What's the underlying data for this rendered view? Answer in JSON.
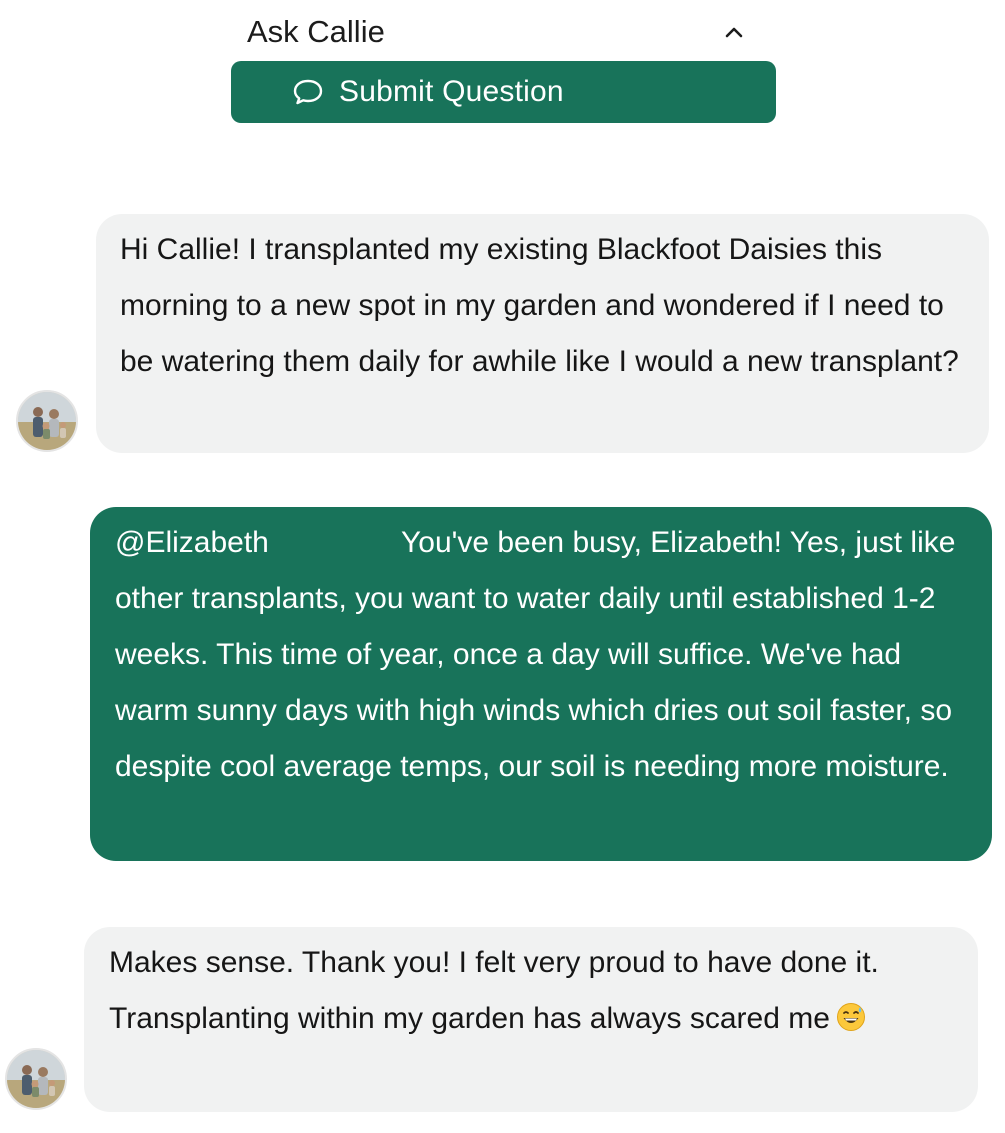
{
  "panel": {
    "title": "Ask Callie",
    "collapse_icon": "chevron-up-icon"
  },
  "submit_button": {
    "label": "Submit Question",
    "icon": "speech-bubble-icon"
  },
  "messages": [
    {
      "sender": "user",
      "text": "Hi Callie! I transplanted my existing Blackfoot Daisies this morning to a new spot in my garden and wondered if I need to be watering them daily for awhile like I would a new transplant?"
    },
    {
      "sender": "expert",
      "mention": "@Elizabeth",
      "text": "You've been busy, Elizabeth! Yes, just like other transplants, you want to water daily until established 1-2 weeks. This time of year, once a day will suffice. We've had warm sunny days with high winds which dries out soil faster, so despite cool average temps, our soil is needing more moisture."
    },
    {
      "sender": "user",
      "text": "Makes sense. Thank you! I felt very proud to have done it. Transplanting within my garden has always scared me",
      "emoji": "grinning-sweat-emoji"
    }
  ],
  "colors": {
    "brand_green": "#18735a",
    "user_bubble": "#f1f2f2",
    "text_dark": "#161616"
  }
}
